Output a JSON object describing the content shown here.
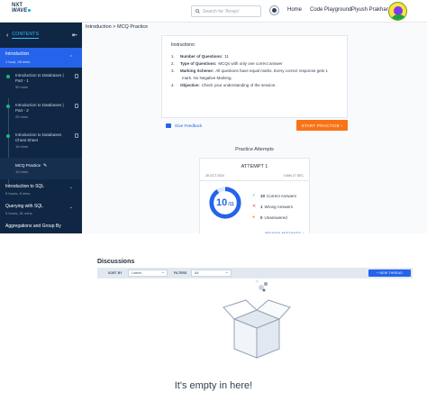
{
  "topnav": {
    "logo_line1": "NXT",
    "logo_line2": "WAVE",
    "search_placeholder": "Search for 'Arrays'",
    "home_label": "Home",
    "code_playground_label": "Code Playground",
    "user_name": "Piyush Prakhar"
  },
  "sidebar": {
    "contents_label": "CONTENTS",
    "modules": [
      {
        "title": "Introduction",
        "meta": "1 hour, 28 mins",
        "active": true
      }
    ],
    "topics": [
      {
        "title": "Introduction to Databases | Part - 1",
        "meta": "30 mins"
      },
      {
        "title": "Introduction to Databases | Part - 2",
        "meta": "25 mins"
      },
      {
        "title": "Introduction to Databases Cheat Sheet",
        "meta": "15 mins"
      },
      {
        "title": "MCQ Practice",
        "meta": "10 mins",
        "active": true
      }
    ],
    "next_modules": [
      {
        "title": "Introduction to SQL",
        "meta": "5 hours, 8 mins"
      },
      {
        "title": "Querying with SQL",
        "meta": "3 hours, 51 mins"
      },
      {
        "title": "Aggregations and Group By",
        "meta": ""
      }
    ]
  },
  "breadcrumb": "Introduction > MCQ Practice",
  "instructions": {
    "heading": "Instructions:",
    "items": [
      {
        "num": "1.",
        "label": "Number of Questions:",
        "text": "11"
      },
      {
        "num": "2.",
        "label": "Type of Questions:",
        "text": "MCQs with only one correct answer"
      },
      {
        "num": "3.",
        "label": "Marking Scheme:",
        "text": "All questions have equal marks. Every correct response gets 1"
      },
      {
        "num": "",
        "label": "",
        "text": "mark. No Negative Marking."
      },
      {
        "num": "4.",
        "label": "Objective:",
        "text": "Check your understanding of the session."
      }
    ]
  },
  "feedback_label": "Give Feedback",
  "start_practice_label": "START PRACTICE  ›",
  "practice_attempts_title": "Practice Attempts",
  "attempt": {
    "title": "ATTEMPT 1",
    "date": "28 OCT 2024",
    "duration": "3 MIN 27 SEC",
    "score": "10",
    "score_unit": "/11",
    "correct_count": "10",
    "correct_label": "Correct Answers",
    "wrong_count": "1",
    "wrong_label": "Wrong Answers",
    "unanswered_count": "0",
    "unanswered_label": "Unanswered",
    "score_fraction": 0.909,
    "review_label": "REVIEW MISTAKES  ›"
  },
  "discussions": {
    "title": "Discussions",
    "sort_label": "SORT BY",
    "sort_value": "Latest",
    "filters_label": "FILTERS",
    "filters_value": "All",
    "new_thread_label": "+ NEW THREAD",
    "empty_text": "It's empty in here!"
  },
  "colors": {
    "sidebar_bg": "#0f2744",
    "accent": "#2563eb",
    "start_button": "#f97316",
    "correct": "#10b981",
    "wrong": "#ef4444",
    "unanswered": "#f59e0b"
  }
}
